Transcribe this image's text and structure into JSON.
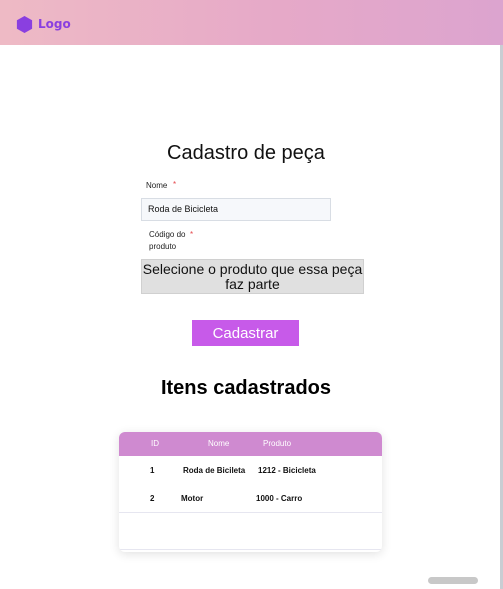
{
  "header": {
    "logo_text": "Logo",
    "logo_icon": "hexagon-icon"
  },
  "form": {
    "title": "Cadastro de peça",
    "nome_label": "Nome",
    "nome_required": "*",
    "nome_value": "Roda de Bicicleta",
    "codigo_label": "Código do produto",
    "codigo_required": "*",
    "codigo_select_value": "Selecione o produto que essa peça faz parte",
    "submit_label": "Cadastrar"
  },
  "list": {
    "title": "Itens cadastrados",
    "columns": [
      "ID",
      "Nome",
      "Produto"
    ],
    "rows": [
      [
        "1",
        "Roda de Bicileta",
        "1212 - Bicicleta"
      ],
      [
        "2",
        "Motor",
        "1000 - Carro"
      ]
    ]
  },
  "colors": {
    "accent": "#c75ae9",
    "logo": "#8a3fe0",
    "table_header": "#cf8ad0"
  }
}
